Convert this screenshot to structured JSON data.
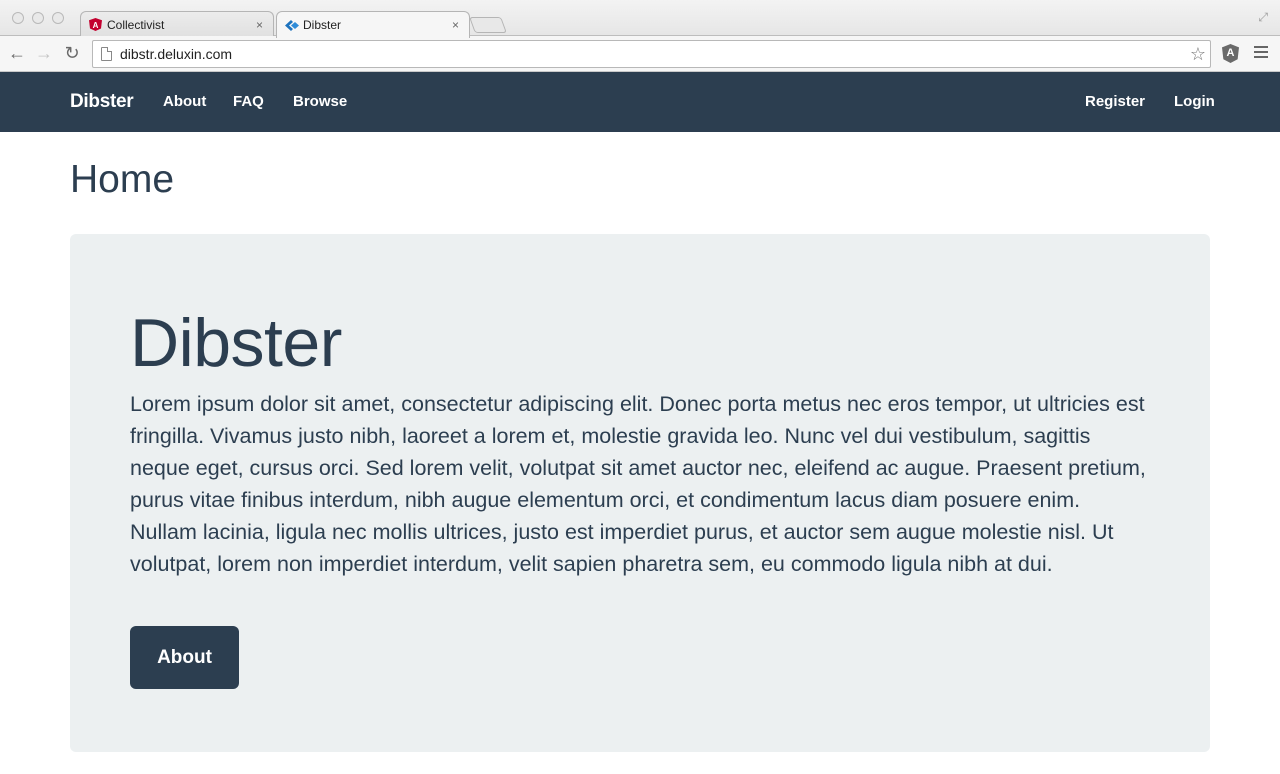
{
  "browser": {
    "tabs": [
      {
        "title": "Collectivist",
        "icon": "angular-icon",
        "close": "×"
      },
      {
        "title": "Dibster",
        "icon": "dibster-icon",
        "close": "×"
      }
    ],
    "url": "dibstr.deluxin.com",
    "nav": {
      "back": "←",
      "forward": "→",
      "reload": "↻",
      "star": "☆",
      "extension": "A",
      "fullscreen": "⤢"
    }
  },
  "navbar": {
    "brand": "Dibster",
    "left_links": [
      "About",
      "FAQ",
      "Browse"
    ],
    "right_links": [
      "Register",
      "Login"
    ],
    "background": "#2c3e50"
  },
  "page": {
    "title": "Home"
  },
  "jumbotron": {
    "title": "Dibster",
    "text": "Lorem ipsum dolor sit amet, consectetur adipiscing elit. Donec porta metus nec eros tempor, ut ultricies est fringilla. Vivamus justo nibh, laoreet a lorem et, molestie gravida leo. Nunc vel dui vestibulum, sagittis neque eget, cursus orci. Sed lorem velit, volutpat sit amet auctor nec, eleifend ac augue. Praesent pretium, purus vitae finibus interdum, nibh augue elementum orci, et condimentum lacus diam posuere enim. Nullam lacinia, ligula nec mollis ultrices, justo est imperdiet purus, et auctor sem augue molestie nisl. Ut volutpat, lorem non imperdiet interdum, velit sapien pharetra sem, eu commodo ligula nibh at dui.",
    "button_label": "About",
    "background": "#ecf0f1"
  }
}
